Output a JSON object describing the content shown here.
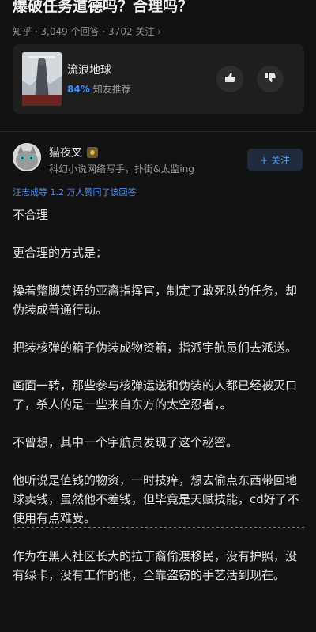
{
  "question": {
    "title": "爆破任务道德吗？合理吗？",
    "meta": "知乎 · 3,049 个回答 · 3702 关注",
    "meta_chevron": "›"
  },
  "movie_card": {
    "title": "流浪地球",
    "recommend_pct": "84%",
    "recommend_label": "知友推荐",
    "upvote_icon": "thumbs-up-icon",
    "downvote_icon": "thumbs-down-icon"
  },
  "author": {
    "name": "猫夜叉",
    "bio": "科幻小说网络写手，扑街&太监ing",
    "follow_label": "+ 关注",
    "endorsement": "汪志成等 1.2 万人赞同了该回答"
  },
  "answer": {
    "paragraphs": [
      "不合理",
      "更合理的方式是：",
      "操着蹩脚英语的亚裔指挥官，制定了敢死队的任务，却伪装成普通行动。",
      "把装核弹的箱子伪装成物资箱，指派宇航员们去派送。",
      "画面一转，那些参与核弹运送和伪装的人都已经被灭口了，杀人的是一些来自东方的太空忍者，。",
      "不曾想，其中一个宇航员发现了这个秘密。",
      "他听说是值钱的物资，一时技痒，想去偷点东西带回地球卖钱，虽然他不差钱，但毕竟是天赋技能，cd好了不使用有点难受。",
      "作为在黑人社区长大的拉丁裔偷渡移民，没有护照，没有绿卡，没有工作的他，全靠盗窃的手艺活到现在。"
    ]
  },
  "colors": {
    "background": "#121212",
    "accent": "#3d8bff",
    "card": "#1e1e1e"
  }
}
